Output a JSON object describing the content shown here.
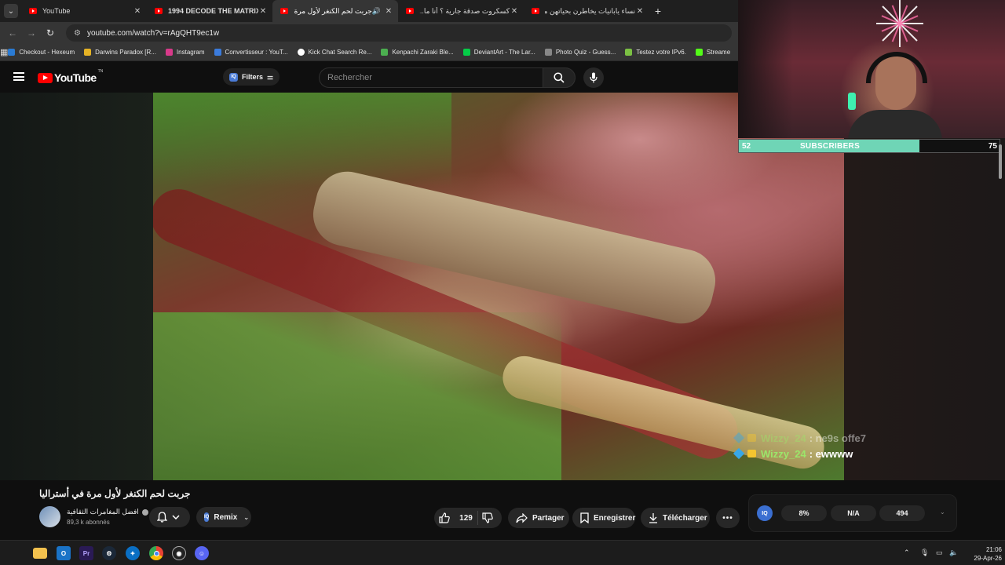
{
  "browser": {
    "tabs": [
      {
        "title": "YouTube",
        "active": false,
        "bold": false,
        "sound": false
      },
      {
        "title": "1994 DECODE THE MATRIX // ...",
        "active": false,
        "bold": true,
        "sound": false
      },
      {
        "title": "جربت لحم الكنغر لأول مرة في...",
        "active": true,
        "bold": false,
        "sound": true
      },
      {
        "title": "كسكروت صدقة جارية ؟ أنا ما...",
        "active": false,
        "bold": false,
        "sound": false
      },
      {
        "title": "نساء يابانيات يخاطرن بحياتهن من...",
        "active": false,
        "bold": false,
        "sound": false
      }
    ],
    "url": "youtube.com/watch?v=rAgQHT9ec1w",
    "bookmarks": [
      {
        "label": "Checkout - Hexeum",
        "color": "#2a7bd4"
      },
      {
        "label": "Darwins Paradox [R...",
        "color": "#e6b325"
      },
      {
        "label": "Instagram",
        "color": "#d83a8a"
      },
      {
        "label": "Convertisseur : YouT...",
        "color": "#3b7bdc"
      },
      {
        "label": "Kick Chat Search Re...",
        "color": "#ffffff"
      },
      {
        "label": "Kenpachi Zaraki Ble...",
        "color": "#4caf50"
      },
      {
        "label": "DeviantArt - The Lar...",
        "color": "#05cc47"
      },
      {
        "label": "Photo Quiz - Guess...",
        "color": "#888888"
      },
      {
        "label": "Testez votre IPv6.",
        "color": "#7bc043"
      },
      {
        "label": "Streame",
        "color": "#53fc18"
      }
    ]
  },
  "youtube": {
    "logo_text": "YouTube",
    "logo_tm": "TN",
    "filters_label": "Filters",
    "filters_badge": "IQ",
    "search_placeholder": "Rechercher",
    "video_title": "جربت لحم الكنغر لأول مرة في أستراليا",
    "channel_name": "افضل المغامرات الثقافية",
    "channel_subs": "89,3 k abonnés",
    "remix_label": "Remix",
    "likes": "129",
    "share_label": "Partager",
    "save_label": "Enregistrer",
    "download_label": "Télécharger",
    "stats": {
      "badge": "IQ",
      "percent": "8%",
      "na": "N/A",
      "count": "494"
    }
  },
  "stream_overlay": {
    "chat": [
      {
        "user": "Wizzy_24",
        "message": "ne9s offe7",
        "faded": true
      },
      {
        "user": "Wizzy_24",
        "message": "ewwww",
        "faded": false
      }
    ],
    "subs_goal": {
      "current": "52",
      "label": "SUBSCRIBERS",
      "target": "75",
      "progress_fraction": 0.6933
    }
  },
  "taskbar": {
    "time": "21:06",
    "date": "29-Apr-26",
    "apps": [
      "start",
      "file-explorer",
      "outlook",
      "premiere-pro",
      "steam",
      "battle-net",
      "chrome",
      "obs",
      "discord"
    ]
  },
  "colors": {
    "youtube_red": "#ff0000",
    "subs_fill": "#6fd5b6",
    "chat_user": "#9be66a"
  }
}
